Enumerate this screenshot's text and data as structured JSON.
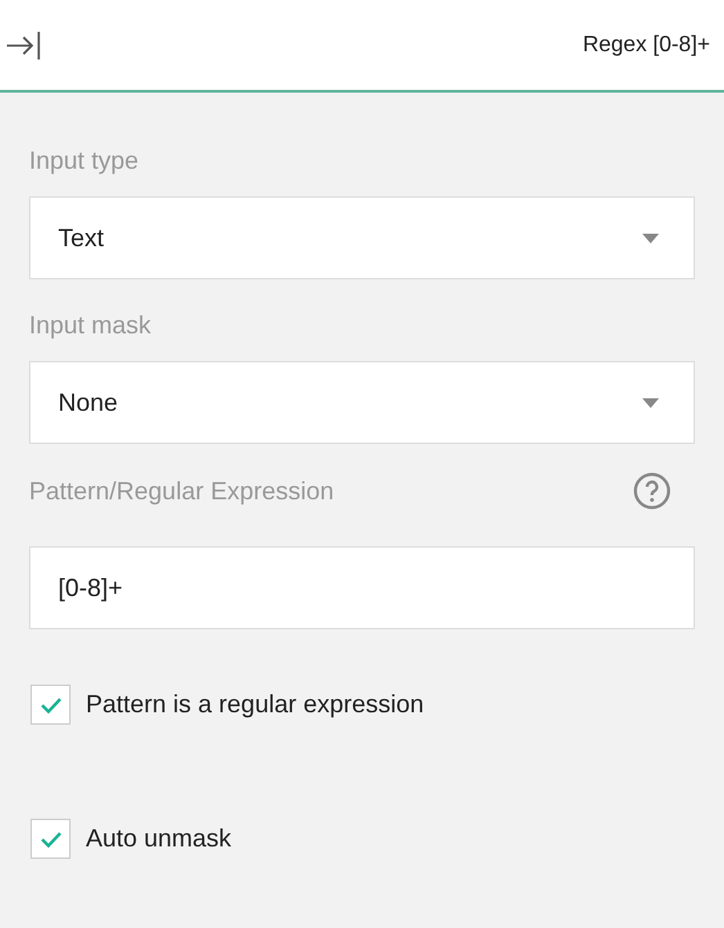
{
  "header": {
    "title": "Regex [0-8]+"
  },
  "fields": [
    {
      "kind": "select",
      "label": "Input type",
      "value": "Text"
    },
    {
      "kind": "select",
      "label": "Input mask",
      "value": "None"
    },
    {
      "kind": "text",
      "label": "Pattern/Regular Expression",
      "value": "[0-8]+",
      "help": true
    }
  ],
  "checkboxes": [
    {
      "label": "Pattern is a regular expression",
      "checked": true
    },
    {
      "label": "Auto unmask",
      "checked": true
    }
  ]
}
